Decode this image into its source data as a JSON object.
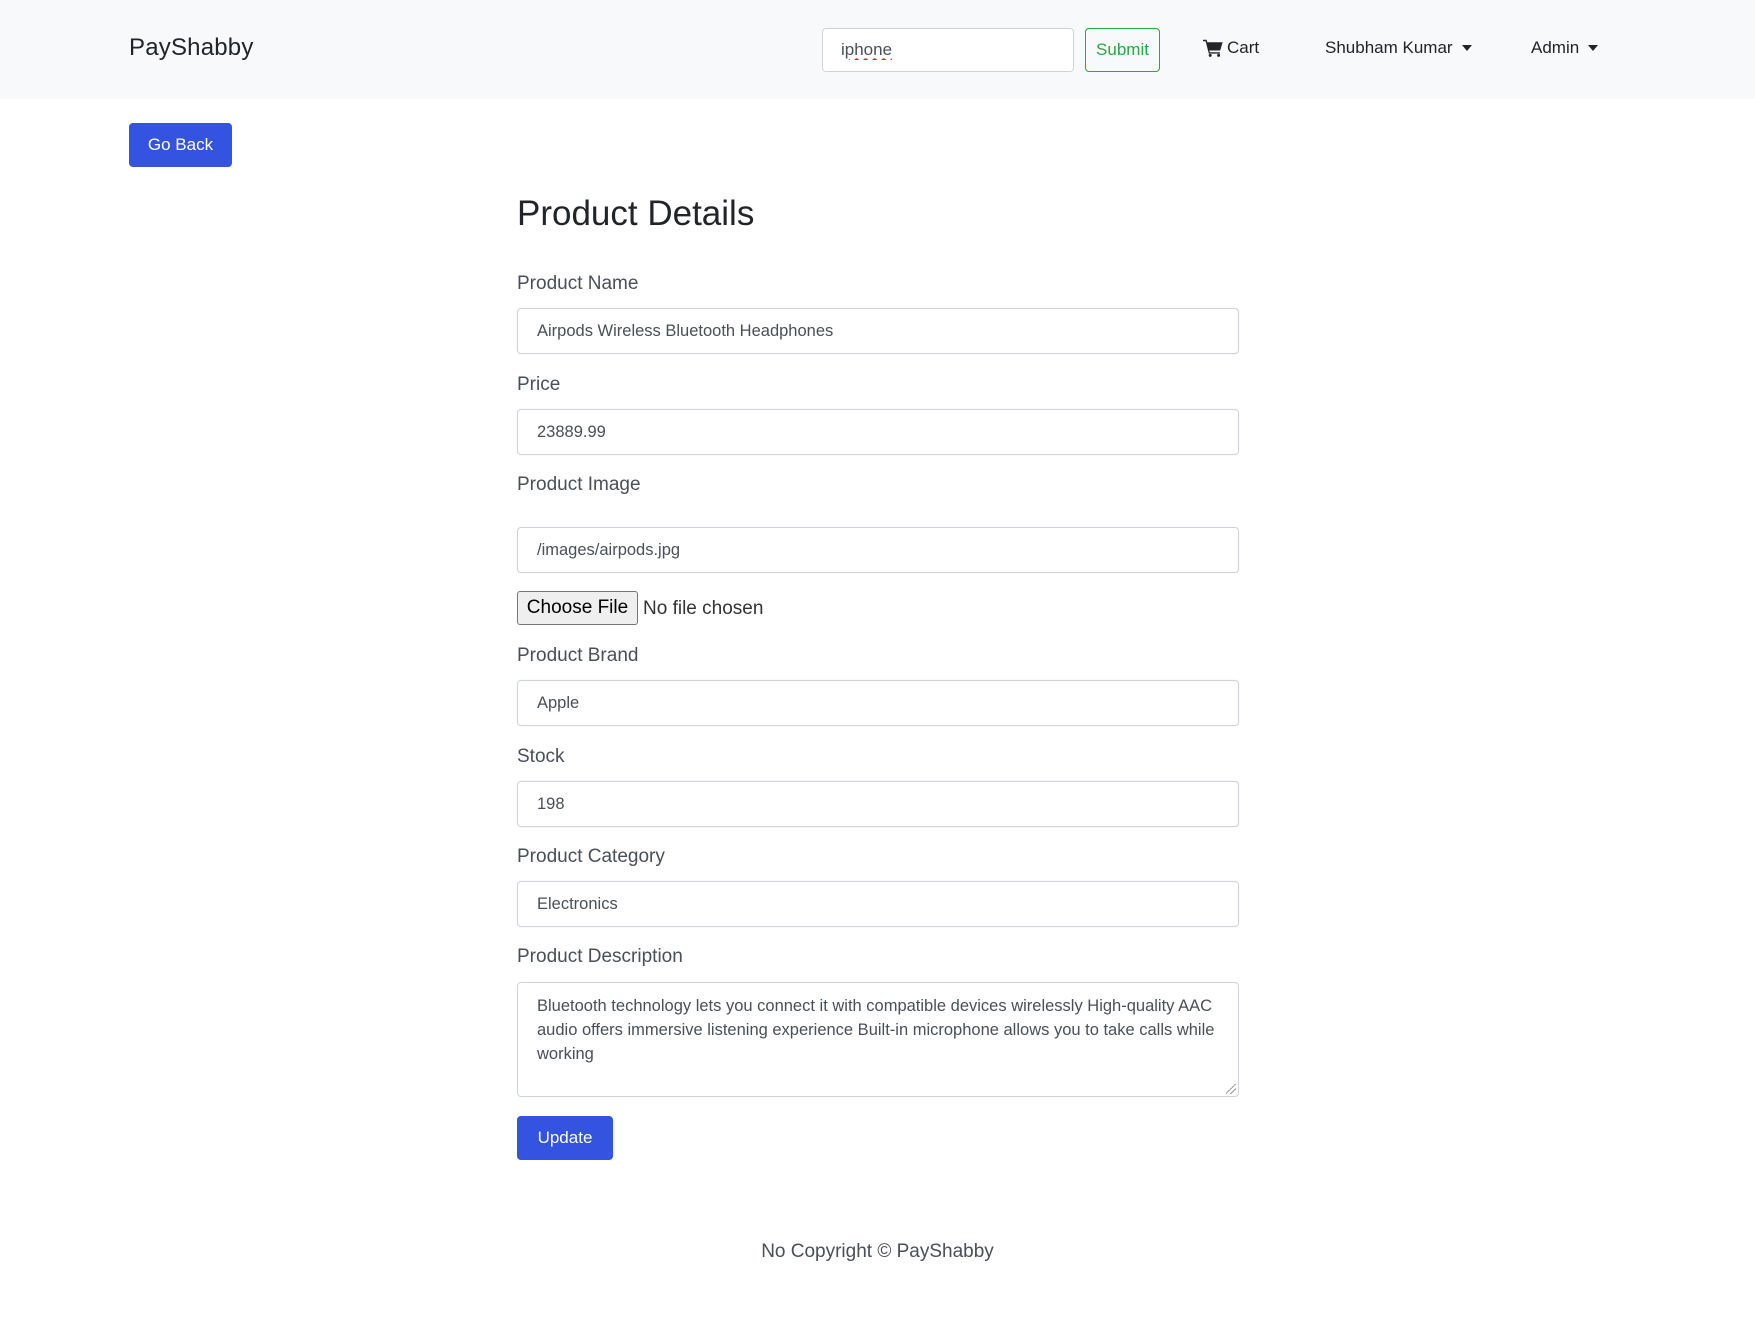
{
  "header": {
    "brand": "PayShabby",
    "search": {
      "value": "iphone",
      "placeholder": ""
    },
    "submit_label": "Submit",
    "cart_label": "Cart",
    "user_menu_label": "Shubham Kumar",
    "admin_menu_label": "Admin"
  },
  "actions": {
    "go_back_label": "Go Back",
    "update_label": "Update"
  },
  "form": {
    "title": "Product Details",
    "name": {
      "label": "Product Name",
      "value": "Airpods Wireless Bluetooth Headphones"
    },
    "price": {
      "label": "Price",
      "value": "23889.99"
    },
    "image": {
      "label": "Product Image",
      "value": "/images/airpods.jpg",
      "choose_file_label": "Choose File",
      "file_status": "No file chosen"
    },
    "brand": {
      "label": "Product Brand",
      "value": "Apple"
    },
    "stock": {
      "label": "Stock",
      "value": "198"
    },
    "category": {
      "label": "Product Category",
      "value": "Electronics"
    },
    "description": {
      "label": "Product Description",
      "value": "Bluetooth technology lets you connect it with compatible devices wirelessly High-quality AAC audio offers immersive listening experience Built-in microphone allows you to take calls while working"
    }
  },
  "footer": {
    "text": "No Copyright © PayShabby"
  },
  "colors": {
    "navbar_bg": "#f8f9fa",
    "primary": "#3353e0",
    "success": "#28a745",
    "border": "#ced4da"
  }
}
